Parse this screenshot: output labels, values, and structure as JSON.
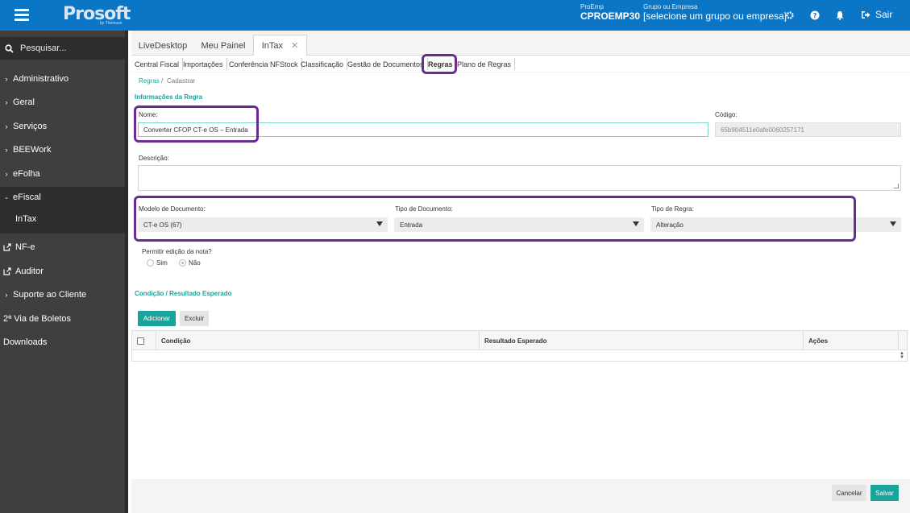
{
  "header": {
    "logo": "Prosoft",
    "logo_sub": "by Thomson",
    "proemp_label": "ProEmp",
    "proemp_value": "CPROEMP30",
    "group_label": "Grupo ou Empresa",
    "group_value": "[selecione um grupo ou empresa]",
    "logout_label": "Sair"
  },
  "sidebar": {
    "search_placeholder": "Pesquisar...",
    "items": [
      {
        "label": "Administrativo"
      },
      {
        "label": "Geral"
      },
      {
        "label": "Serviços"
      },
      {
        "label": "BEEWork"
      },
      {
        "label": "eFolha"
      },
      {
        "label": "eFiscal"
      },
      {
        "label": "InTax"
      },
      {
        "label": "NF-e"
      },
      {
        "label": "Auditor"
      },
      {
        "label": "Suporte ao Cliente"
      },
      {
        "label": "2ª Via de Boletos"
      },
      {
        "label": "Downloads"
      }
    ]
  },
  "tabs": [
    {
      "label": "LiveDesktop"
    },
    {
      "label": "Meu Painel"
    },
    {
      "label": "InTax",
      "close": "✕"
    }
  ],
  "subtabs": [
    {
      "label": "Central Fiscal"
    },
    {
      "label": "Importações"
    },
    {
      "label": "Conferência NFStock"
    },
    {
      "label": "Classificação"
    },
    {
      "label": "Gestão de Documentos"
    },
    {
      "label": "Regras"
    },
    {
      "label": "Plano de Regras"
    }
  ],
  "breadcrumb": {
    "root": "Regras",
    "separator": "/",
    "current": "Cadastrar"
  },
  "form": {
    "section_title": "Informações da Regra",
    "nome_label": "Nome:",
    "nome_value": "Converter CFOP CT-e OS – Entrada",
    "codigo_label": "Código:",
    "codigo_value": "65b904511e0afe0060257171",
    "descricao_label": "Descrição:",
    "modelo_label": "Modelo de Documento:",
    "modelo_value": "CT-e OS (67)",
    "tipo_doc_label": "Tipo de Documento:",
    "tipo_doc_value": "Entrada",
    "tipo_regra_label": "Tipo de Regra:",
    "tipo_regra_value": "Alteração",
    "permitir_label": "Permitir edição da nota?",
    "option_sim": "Sim",
    "option_nao": "Não",
    "selected_option": "Não"
  },
  "conditions": {
    "section_title": "Condição / Resultado Esperado",
    "add_label": "Adicionar",
    "remove_label": "Excluir",
    "columns": [
      "Condição",
      "Resultado Esperado",
      "Ações"
    ]
  },
  "footer": {
    "cancel_label": "Cancelar",
    "save_label": "Salvar"
  },
  "colors": {
    "accent": "#1aa39a",
    "topbar": "#0b76c6",
    "sidebar": "#3f3f3f",
    "highlight": "#6a2c91"
  }
}
